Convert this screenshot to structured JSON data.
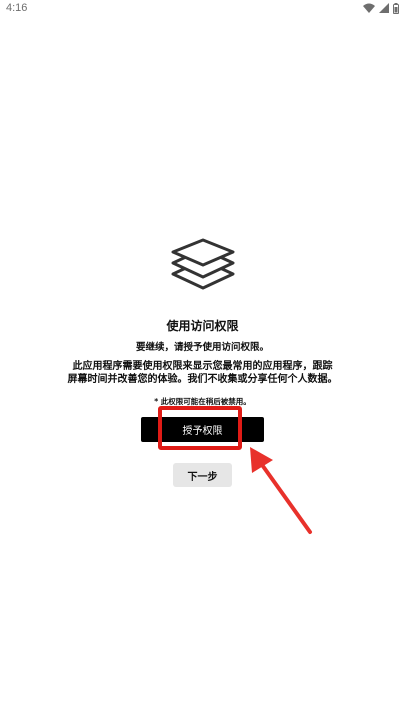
{
  "status_bar": {
    "time": "4:16",
    "icons": [
      "wifi-icon",
      "cellular-signal-icon",
      "battery-icon"
    ]
  },
  "screen": {
    "logo_icon": "layers-stack-icon",
    "title": "使用访问权限",
    "subtitle": "要继续，请授予使用访问权限。",
    "description_line1": "此应用程序需要使用权限来显示您最常用的应用程序，跟踪",
    "description_line2": "屏幕时间并改善您的体验。我们不收集或分享任何个人数据。",
    "note": "* 此权限可能在稍后被禁用。",
    "grant_button_label": "授予权限",
    "next_button_label": "下一步"
  },
  "annotation": {
    "highlight_color": "#e01b16",
    "arrow_color": "#e8312b"
  }
}
